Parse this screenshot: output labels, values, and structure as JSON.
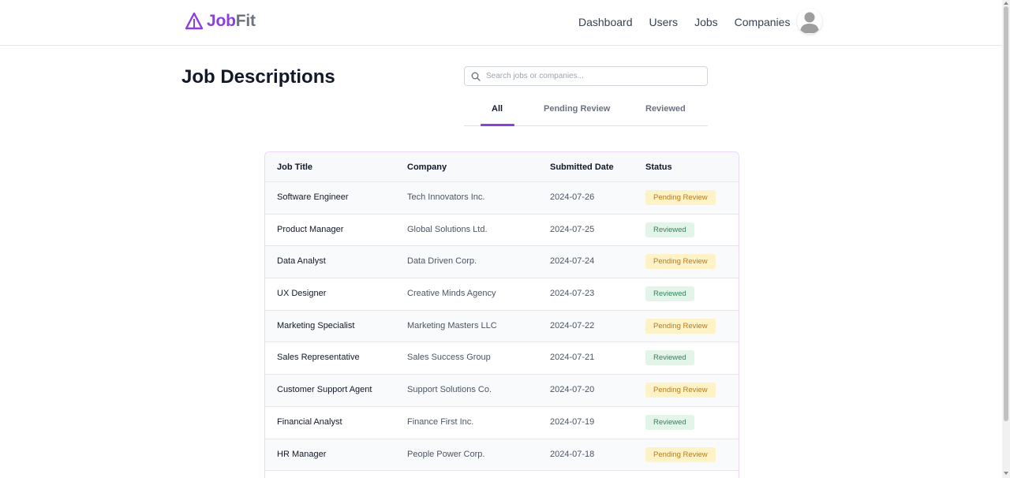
{
  "brand": {
    "job": "Job",
    "fit": "Fit",
    "color": "#8b3fe0"
  },
  "nav": [
    {
      "label": "Dashboard",
      "name": "nav-dashboard"
    },
    {
      "label": "Users",
      "name": "nav-users"
    },
    {
      "label": "Jobs",
      "name": "nav-jobs"
    },
    {
      "label": "Companies",
      "name": "nav-companies"
    }
  ],
  "avatar_icon": "user-avatar-icon",
  "page": {
    "title": "Job Descriptions"
  },
  "search": {
    "placeholder": "Search jobs or companies...",
    "value": "",
    "icon": "search-icon"
  },
  "tabs": [
    {
      "label": "All",
      "active": true
    },
    {
      "label": "Pending Review",
      "active": false
    },
    {
      "label": "Reviewed",
      "active": false
    }
  ],
  "table": {
    "columns": [
      "Job Title",
      "Company",
      "Submitted Date",
      "Status"
    ],
    "rows": [
      {
        "title": "Software Engineer",
        "company": "Tech Innovators Inc.",
        "date": "2024-07-26",
        "status": "Pending Review",
        "status_kind": "pending"
      },
      {
        "title": "Product Manager",
        "company": "Global Solutions Ltd.",
        "date": "2024-07-25",
        "status": "Reviewed",
        "status_kind": "reviewed"
      },
      {
        "title": "Data Analyst",
        "company": "Data Driven Corp.",
        "date": "2024-07-24",
        "status": "Pending Review",
        "status_kind": "pending"
      },
      {
        "title": "UX Designer",
        "company": "Creative Minds Agency",
        "date": "2024-07-23",
        "status": "Reviewed",
        "status_kind": "reviewed"
      },
      {
        "title": "Marketing Specialist",
        "company": "Marketing Masters LLC",
        "date": "2024-07-22",
        "status": "Pending Review",
        "status_kind": "pending"
      },
      {
        "title": "Sales Representative",
        "company": "Sales Success Group",
        "date": "2024-07-21",
        "status": "Reviewed",
        "status_kind": "reviewed"
      },
      {
        "title": "Customer Support Agent",
        "company": "Support Solutions Co.",
        "date": "2024-07-20",
        "status": "Pending Review",
        "status_kind": "pending"
      },
      {
        "title": "Financial Analyst",
        "company": "Finance First Inc.",
        "date": "2024-07-19",
        "status": "Reviewed",
        "status_kind": "reviewed"
      },
      {
        "title": "HR Manager",
        "company": "People Power Corp.",
        "date": "2024-07-18",
        "status": "Pending Review",
        "status_kind": "pending"
      }
    ]
  },
  "colors": {
    "accent": "#8b3fe0",
    "pending_bg": "#fef3c7",
    "pending_text": "#b7791f",
    "reviewed_bg": "#e3f4e8",
    "reviewed_text": "#2f855a"
  }
}
